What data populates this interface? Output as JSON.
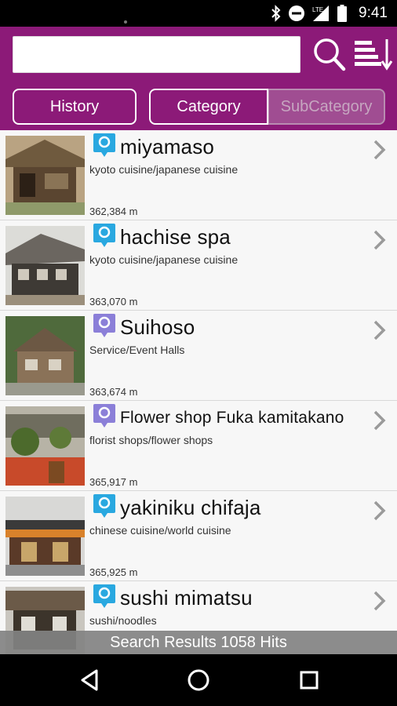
{
  "status_bar": {
    "time": "9:41",
    "network": "LTE",
    "icons": [
      "bluetooth-icon",
      "do-not-disturb-icon",
      "signal-icon",
      "battery-icon"
    ]
  },
  "search": {
    "value": "",
    "placeholder": ""
  },
  "tabs": {
    "history": "History",
    "category": "Category",
    "subcategory": "SubCategory"
  },
  "results": [
    {
      "title": "miyamaso",
      "category": "kyoto cuisine/japanese cuisine",
      "distance": "362,384 m",
      "pin": "blue"
    },
    {
      "title": "hachise spa",
      "category": "kyoto cuisine/japanese cuisine",
      "distance": "363,070 m",
      "pin": "blue"
    },
    {
      "title": "Suihoso",
      "category": "Service/Event Halls",
      "distance": "363,674 m",
      "pin": "purple"
    },
    {
      "title": "Flower shop Fuka kamitakano",
      "category": "florist shops/flower shops",
      "distance": "365,917 m",
      "pin": "purple"
    },
    {
      "title": "yakiniku chifaja",
      "category": "chinese cuisine/world cuisine",
      "distance": "365,925 m",
      "pin": "blue"
    },
    {
      "title": "sushi mimatsu",
      "category": "sushi/noodles",
      "distance": "",
      "pin": "blue"
    }
  ],
  "results_bar": "Search Results 1058 Hits",
  "colors": {
    "header": "#8c1a78",
    "pin_blue": "#29a8e0",
    "pin_purple": "#8b7fd8"
  }
}
